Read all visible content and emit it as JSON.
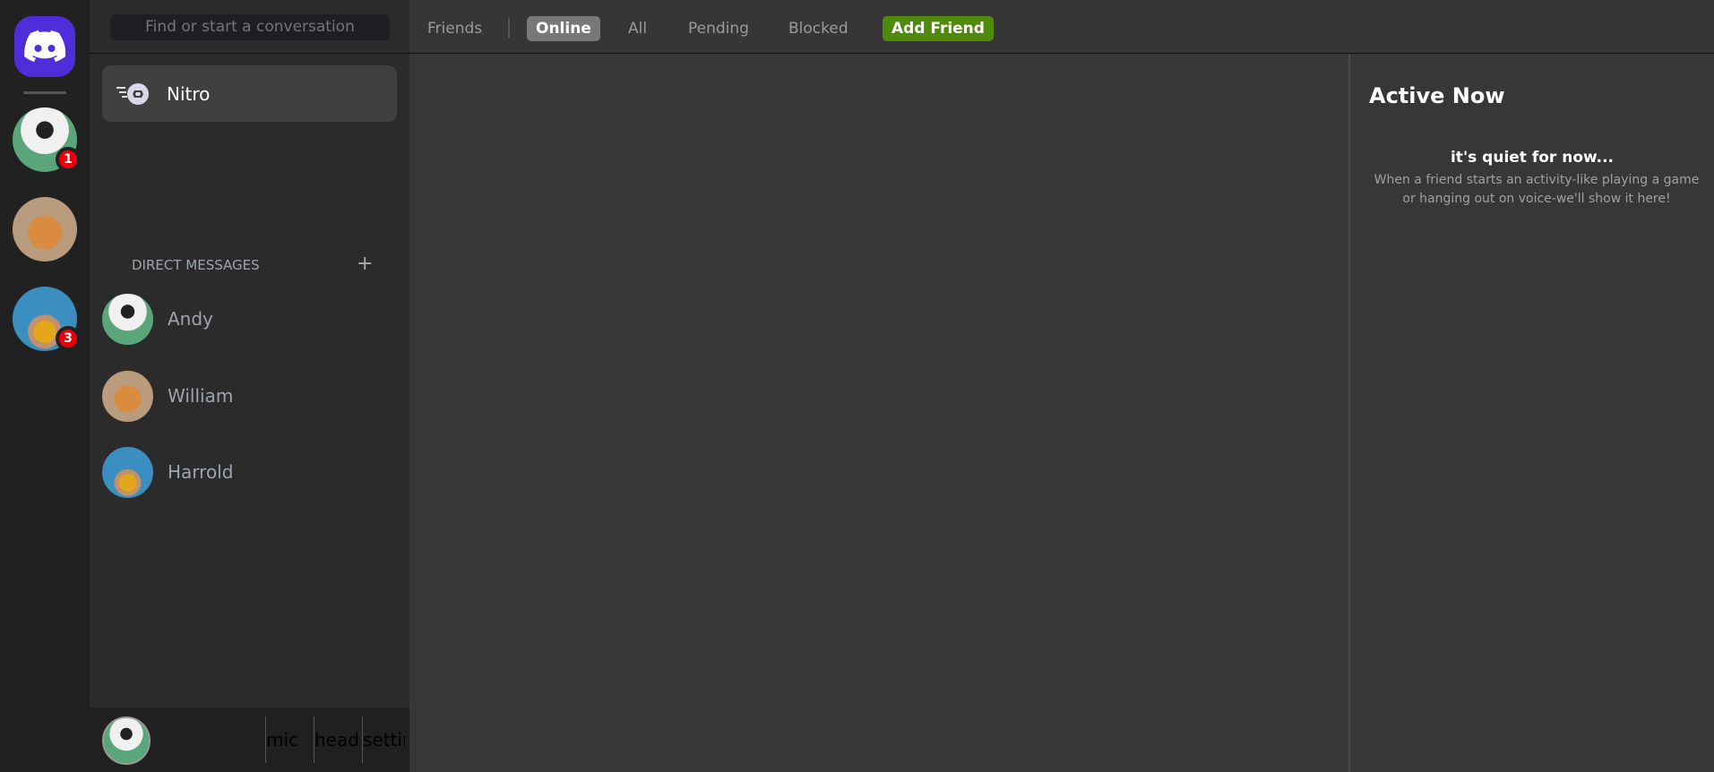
{
  "servers": [
    {
      "name": "Andy",
      "avatar": "cat-black-white",
      "badge": "1"
    },
    {
      "name": "William",
      "avatar": "cat-orange",
      "badge": null
    },
    {
      "name": "Harrold",
      "avatar": "dog-yellow-shirt",
      "badge": "3"
    }
  ],
  "sidebar": {
    "search_placeholder": "Find or start a conversation",
    "nitro_label": "Nitro",
    "dm_header": "DIRECT MESSAGES",
    "dm_add": "+",
    "dms": [
      {
        "name": "Andy"
      },
      {
        "name": "William"
      },
      {
        "name": "Harrold"
      }
    ]
  },
  "user_panel": {
    "mic_alt": "mic",
    "headphones_alt": "headphones",
    "settings_alt": "settings"
  },
  "header": {
    "friends": "Friends",
    "tabs": [
      "Online",
      "All",
      "Pending",
      "Blocked"
    ],
    "active_tab": "Online",
    "add_friend": "Add Friend"
  },
  "active_now": {
    "title": "Active Now",
    "empty_title": "it's quiet for now...",
    "empty_desc": "When a friend starts an activity-like playing a game or hanging out on voice-we'll show it here!"
  },
  "colors": {
    "brand": "#4f2ed9",
    "badge": "#e8000d",
    "add_friend": "#4f8a0b"
  }
}
